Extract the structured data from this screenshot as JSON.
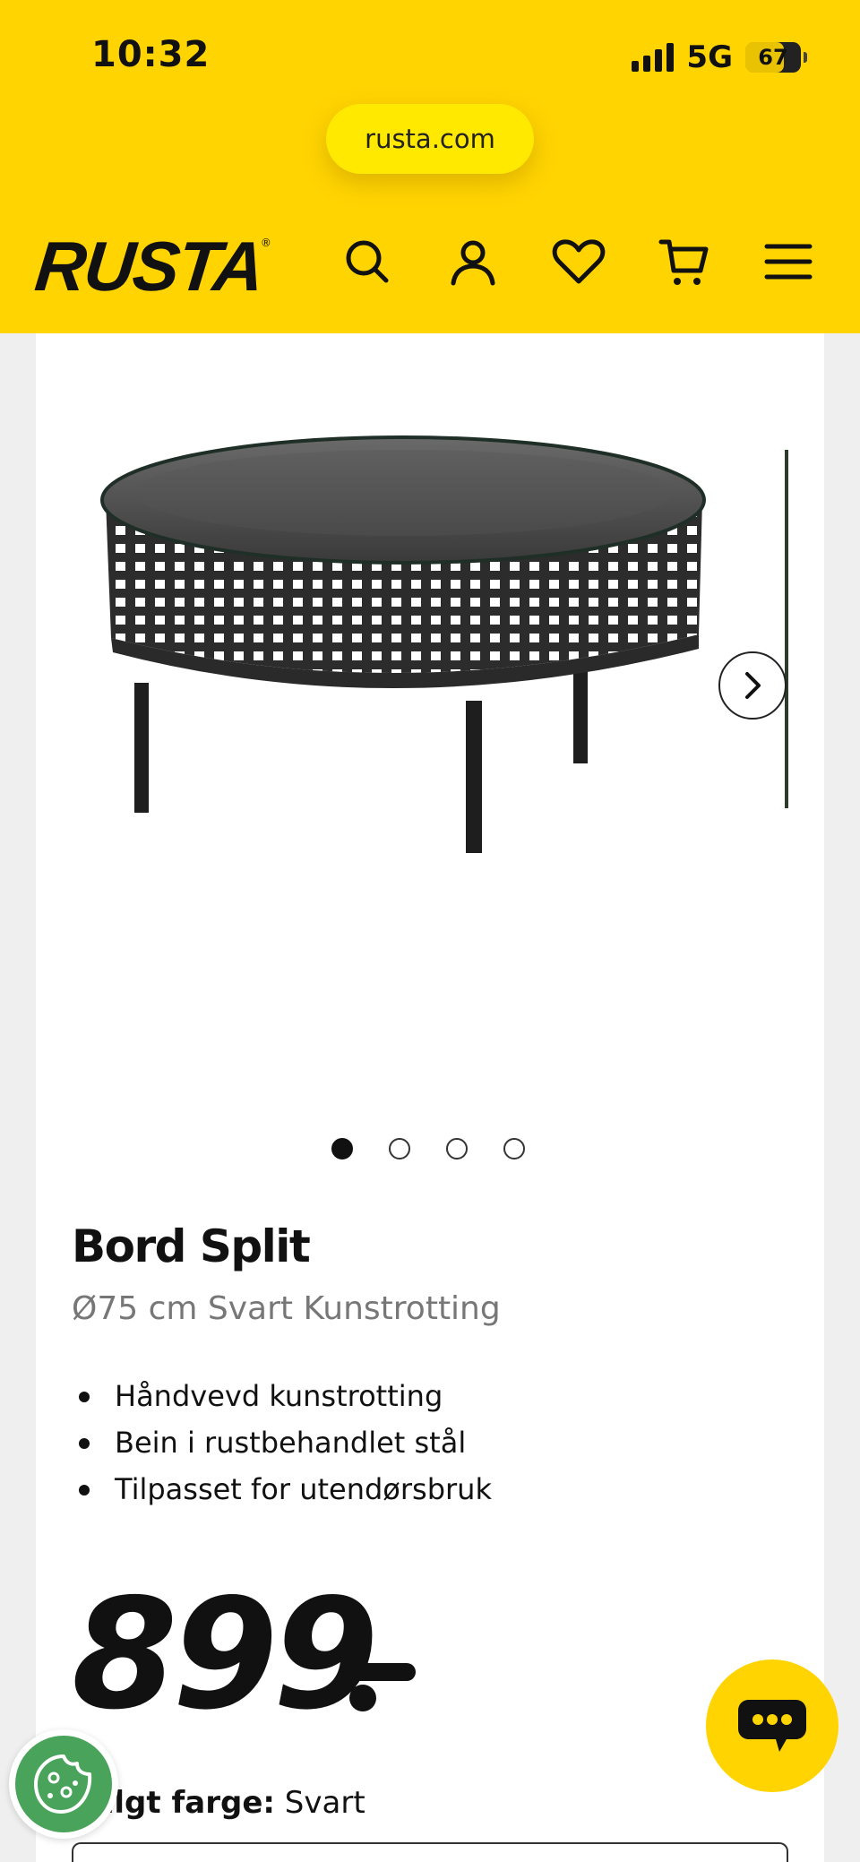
{
  "status_bar": {
    "time": "10:32",
    "network": "5G",
    "battery": "67"
  },
  "browser": {
    "url": "rusta.com"
  },
  "header": {
    "logo": "RUSTA",
    "icons": [
      "search-icon",
      "account-icon",
      "heart-icon",
      "cart-icon",
      "menu-icon"
    ]
  },
  "gallery": {
    "image_count": 4,
    "active_index": 0,
    "image_alt": "Bord Split"
  },
  "product": {
    "name": "Bord Split",
    "subtitle": "Ø75 cm Svart Kunstrotting",
    "features": [
      "Håndvevd kunstrotting",
      "Bein i rustbehandlet stål",
      "Tilpasset for utendørsbruk"
    ],
    "price": "899"
  },
  "color_select": {
    "label": "Valgt farge:",
    "value": "Svart"
  },
  "colors": {
    "brand_yellow": "#ffd400",
    "text": "#111111",
    "muted": "#777777",
    "cookie_green": "#4aa35a"
  }
}
